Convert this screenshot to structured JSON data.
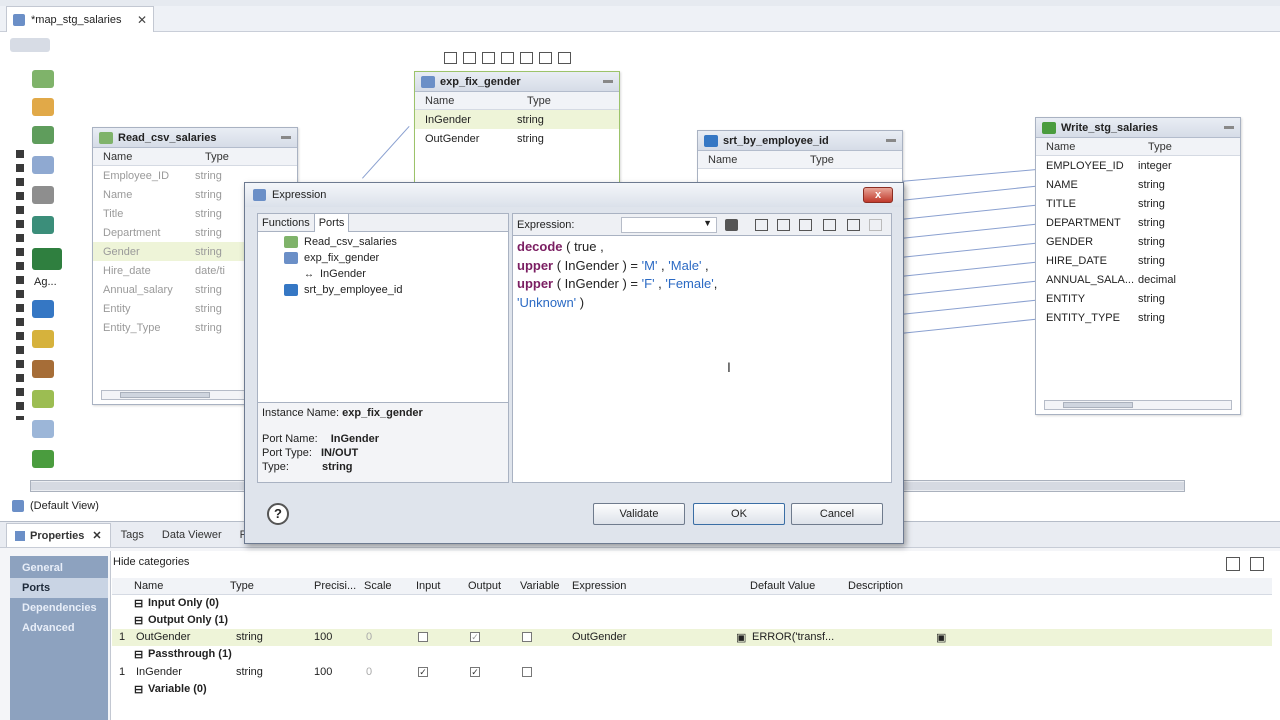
{
  "editor": {
    "tab_title": "*map_stg_salaries",
    "close": "✕"
  },
  "palette": {
    "aggregator_label": "Ag..."
  },
  "objects": {
    "read_csv": {
      "title": "Read_csv_salaries",
      "col_name": "Name",
      "col_type": "Type",
      "rows": [
        {
          "name": "Employee_ID",
          "type": "string"
        },
        {
          "name": "Name",
          "type": "string"
        },
        {
          "name": "Title",
          "type": "string"
        },
        {
          "name": "Department",
          "type": "string"
        },
        {
          "name": "Gender",
          "type": "string"
        },
        {
          "name": "Hire_date",
          "type": "date/ti"
        },
        {
          "name": "Annual_salary",
          "type": "string"
        },
        {
          "name": "Entity",
          "type": "string"
        },
        {
          "name": "Entity_Type",
          "type": "string"
        }
      ]
    },
    "exp_fix_gender": {
      "title": "exp_fix_gender",
      "col_name": "Name",
      "col_type": "Type",
      "rows": [
        {
          "name": "InGender",
          "type": "string"
        },
        {
          "name": "OutGender",
          "type": "string"
        }
      ]
    },
    "srt_by_employee": {
      "title": "srt_by_employee_id",
      "col_name": "Name",
      "col_type": "Type"
    },
    "write_stg": {
      "title": "Write_stg_salaries",
      "col_name": "Name",
      "col_type": "Type",
      "rows": [
        {
          "name": "EMPLOYEE_ID",
          "type": "integer"
        },
        {
          "name": "NAME",
          "type": "string"
        },
        {
          "name": "TITLE",
          "type": "string"
        },
        {
          "name": "DEPARTMENT",
          "type": "string"
        },
        {
          "name": "GENDER",
          "type": "string"
        },
        {
          "name": "HIRE_DATE",
          "type": "string"
        },
        {
          "name": "ANNUAL_SALA...",
          "type": "decimal"
        },
        {
          "name": "ENTITY",
          "type": "string"
        },
        {
          "name": "ENTITY_TYPE",
          "type": "string"
        }
      ]
    }
  },
  "default_view": "(Default View)",
  "dialog": {
    "title": "Expression",
    "close": "x",
    "tabs": [
      "Functions",
      "Ports"
    ],
    "tree": [
      "Read_csv_salaries",
      "exp_fix_gender",
      "InGender",
      "srt_by_employee_id"
    ],
    "instance_label": "Instance Name:",
    "instance_value": "exp_fix_gender",
    "port_name_label": "Port Name:",
    "port_name_value": "InGender",
    "port_type_label": "Port Type:",
    "port_type_value": "IN/OUT",
    "type_label": "Type:",
    "type_value": "string",
    "expression_label": "Expression:",
    "expr": {
      "l1_kw": "decode",
      "l1_rest": " ( true ,",
      "l2_kw": "upper",
      "l2_rest": " ( InGender ) = ",
      "l2_s1": "'M'",
      "l2_sep": " , ",
      "l2_s2": "'Male'",
      "l2_end": " ,",
      "l3_kw": "upper",
      "l3_rest": " ( InGender ) = ",
      "l3_s1": "'F'",
      "l3_sep": " , ",
      "l3_s2": "'Female'",
      "l3_end": ",",
      "l4_s": "'Unknown'",
      "l4_end": " )"
    },
    "buttons": {
      "validate": "Validate",
      "ok": "OK",
      "cancel": "Cancel",
      "help": "?"
    }
  },
  "properties": {
    "tabs": [
      "Properties",
      "Tags",
      "Data Viewer",
      "Pro"
    ],
    "close": "✕",
    "categories": [
      "General",
      "Ports",
      "Dependencies",
      "Advanced"
    ],
    "hide_categories": "Hide categories",
    "headers": [
      "Name",
      "Type",
      "Precisi...",
      "Scale",
      "Input",
      "Output",
      "Variable",
      "Expression",
      "Default Value",
      "Description"
    ],
    "groups": [
      "Input Only (0)",
      "Output Only (1)",
      "Passthrough (1)",
      "Variable (0)"
    ],
    "row_out": {
      "num": "1",
      "name": "OutGender",
      "type": "string",
      "precision": "100",
      "scale": "0",
      "expression": "OutGender",
      "default": "ERROR('transf..."
    },
    "row_pass": {
      "num": "1",
      "name": "InGender",
      "type": "string",
      "precision": "100",
      "scale": "0"
    }
  },
  "colors": {
    "accent": "#7b1e62",
    "string_literal": "#2b6ac4",
    "selection": "#eef4d8",
    "category_bg": "#8da2bf"
  }
}
